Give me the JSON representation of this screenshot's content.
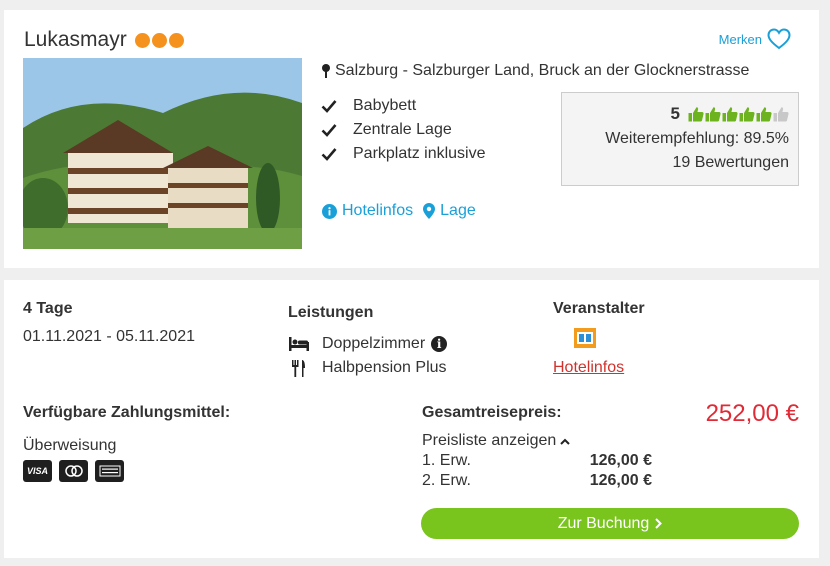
{
  "hotel": {
    "name": "Lukasmayr",
    "category_dots": 3,
    "merken_label": "Merken",
    "location": "Salzburg - Salzburger Land, Bruck an der Glocknerstrasse",
    "features": [
      "Babybett",
      "Zentrale Lage",
      "Parkplatz inklusive"
    ],
    "links": {
      "info": "Hotelinfos",
      "lage": "Lage"
    }
  },
  "rating": {
    "score": "5",
    "thumbs_filled": 5,
    "thumbs_total": 6,
    "recommendation": "Weiterempfehlung: 89.5%",
    "reviews": "19 Bewertungen"
  },
  "offer": {
    "duration": "4 Tage",
    "dates": "01.11.2021 - 05.11.2021",
    "services_title": "Leistungen",
    "room": "Doppelzimmer",
    "board": "Halbpension Plus",
    "operator_title": "Veranstalter",
    "operator_link": "Hotelinfos",
    "payment_title": "Verfügbare Zahlungsmittel:",
    "payment_method": "Überweisung",
    "payment_cards": [
      "VISA",
      "Mastercard",
      "American Express"
    ],
    "total_label": "Gesamtreisepreis:",
    "total_price": "252,00 €",
    "pricelist_label": "Preisliste anzeigen",
    "price_rows": [
      {
        "label": "1. Erw.",
        "amount": "126,00 €"
      },
      {
        "label": "2. Erw.",
        "amount": "126,00 €"
      }
    ],
    "book_label": "Zur Buchung"
  },
  "colors": {
    "accent_blue": "#1aa0d8",
    "dot_orange": "#f5921e",
    "thumb_green": "#6db31f",
    "price_red": "#e02a36",
    "button_green": "#7ac41e"
  }
}
